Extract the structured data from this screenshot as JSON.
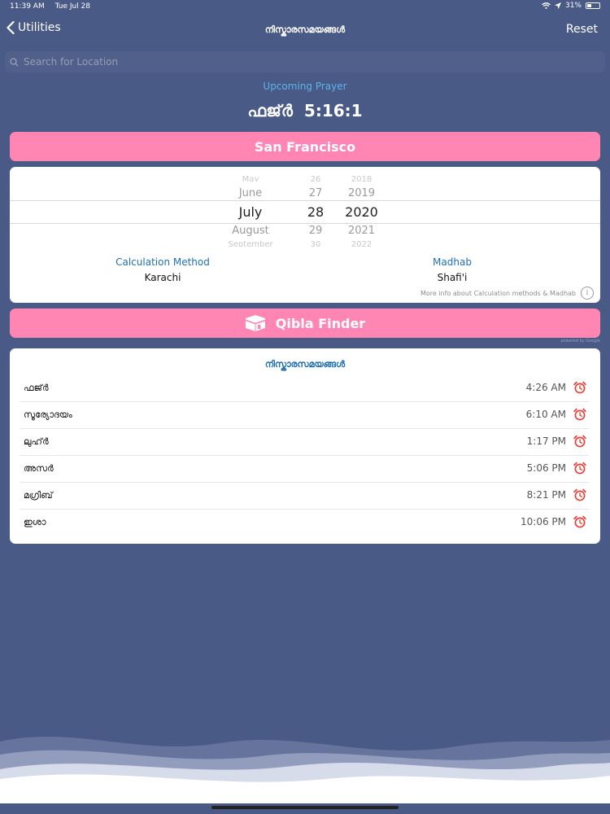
{
  "status_bar": {
    "time": "11:39 AM",
    "date": "Tue Jul 28",
    "battery": "31%"
  },
  "nav": {
    "back_label": "Utilities",
    "title": "നിസ്കാരസമയങ്ങൾ",
    "reset_label": "Reset"
  },
  "search": {
    "placeholder": "Search for Location"
  },
  "upcoming": {
    "label": "Upcoming Prayer",
    "prayer": "ഫജ്ർ",
    "countdown": "5:16:1"
  },
  "city_button": "San Francisco",
  "picker": {
    "months": [
      "May",
      "June",
      "July",
      "August",
      "September"
    ],
    "days": [
      "26",
      "27",
      "28",
      "29",
      "30"
    ],
    "years": [
      "2018",
      "2019",
      "2020",
      "2021",
      "2022"
    ]
  },
  "settings": {
    "calc_label": "Calculation Method",
    "calc_value": "Karachi",
    "madhab_label": "Madhab",
    "madhab_value": "Shafi'i",
    "more_info": "More info about Calculation methods & Madhab"
  },
  "qibla_button": "Qibla Finder",
  "powered_by": "powered by Google",
  "prayer_times": {
    "title": "നിസ്കാരസമയങ്ങൾ",
    "items": [
      {
        "name": "ഫജ്ർ",
        "time": "4:26 AM"
      },
      {
        "name": "സൂര്യോദയം",
        "time": "6:10 AM"
      },
      {
        "name": "ലുഹ്ർ",
        "time": "1:17 PM"
      },
      {
        "name": "അസർ",
        "time": "5:06 PM"
      },
      {
        "name": "മഗ്രിബ്",
        "time": "8:21 PM"
      },
      {
        "name": "ഇശാ",
        "time": "10:06 PM"
      }
    ]
  },
  "colors": {
    "background": "#4a5a86",
    "accent_pink": "#ff86b2",
    "label_blue": "#1f6fb3",
    "upcoming_blue": "#5ab4ee",
    "alarm_red": "#e8413a"
  },
  "icons": {
    "back": "chevron-left-icon",
    "search": "search-icon",
    "qibla": "kaaba-icon",
    "alarm": "alarm-clock-icon",
    "info": "info-icon"
  }
}
